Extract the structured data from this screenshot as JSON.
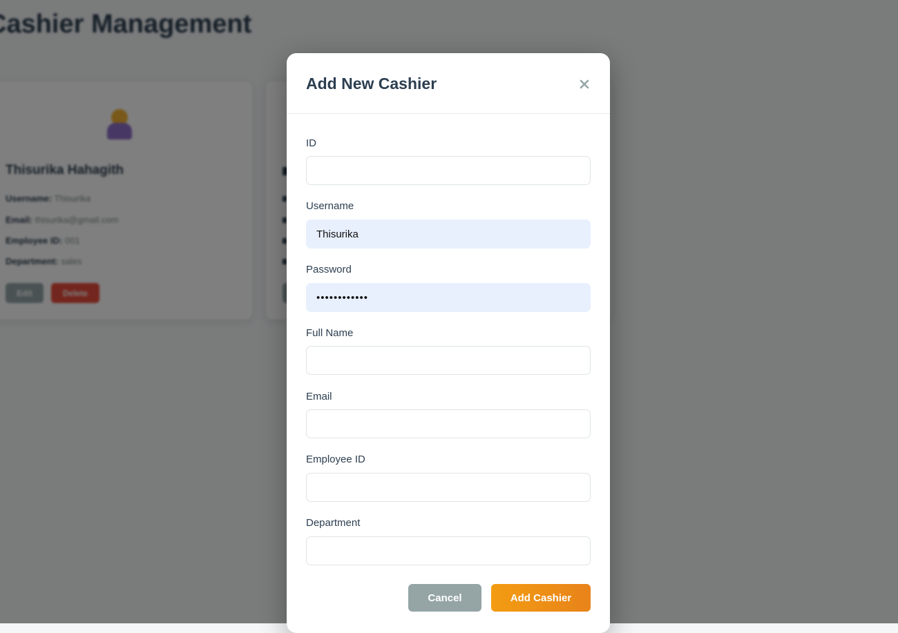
{
  "background_page": {
    "title": "Cashier Management",
    "cards": [
      {
        "name": "Thisurika Hahagith",
        "username_label": "Username:",
        "username": "Thisurika",
        "email_label": "Email:",
        "email": "thisurika@gmail.com",
        "employee_id_label": "Employee ID:",
        "employee_id": "001",
        "department_label": "Department:",
        "department": "sales",
        "edit_label": "Edit",
        "delete_label": "Delete"
      }
    ]
  },
  "modal": {
    "title": "Add New Cashier",
    "close_icon": "close-icon",
    "fields": [
      {
        "label": "ID",
        "value": ""
      },
      {
        "label": "Username",
        "value": "Thisurika"
      },
      {
        "label": "Password",
        "value": "Thisurika123"
      },
      {
        "label": "Full Name",
        "value": ""
      },
      {
        "label": "Email",
        "value": ""
      },
      {
        "label": "Employee ID",
        "value": ""
      },
      {
        "label": "Department",
        "value": ""
      }
    ],
    "cancel_label": "Cancel",
    "submit_label": "Add Cashier"
  },
  "colors": {
    "primary_text": "#2c3e50",
    "submit_button": "#f39c12",
    "cancel_button": "#95a5a6",
    "autofill_background": "#e8f0fe",
    "delete_button": "#e74c3c"
  }
}
